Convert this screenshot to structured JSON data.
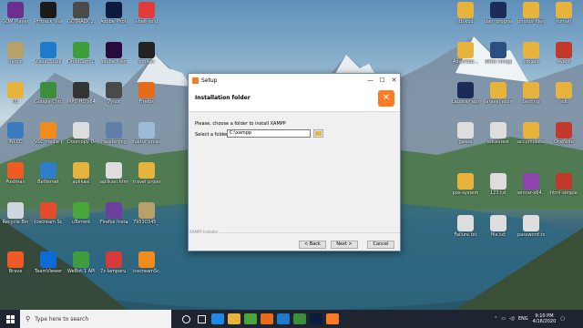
{
  "desktop": {
    "icons": [
      {
        "label": "GOM Player",
        "color": "#6b2f8f"
      },
      {
        "label": "PHtrack Video...",
        "color": "#1b1b1b"
      },
      {
        "label": "GOTRACK 2...",
        "color": "#4a4a4a"
      },
      {
        "label": "Adobe Photosh...",
        "color": "#0c1b3f"
      },
      {
        "label": "shell-void",
        "color": "#e23b3b"
      },
      {
        "label": "heroic",
        "color": "#b8a06a"
      },
      {
        "label": "Visual Studio Code",
        "color": "#1f7acc"
      },
      {
        "label": "DroidCam Client",
        "color": "#3e9e3e"
      },
      {
        "label": "Adobe Premiere",
        "color": "#2a0a3e"
      },
      {
        "label": "project",
        "color": "#222"
      },
      {
        "label": "lib",
        "color": "#e6b43c"
      },
      {
        "label": "Google Chrome",
        "color": "#3c8d3c"
      },
      {
        "label": "MPC-HC x64",
        "color": "#333"
      },
      {
        "label": "Vysor",
        "color": "#4a4a4a"
      },
      {
        "label": "Firefox",
        "color": "#e66b1b"
      },
      {
        "label": "INI.CC",
        "color": "#3b7bbd"
      },
      {
        "label": "VLC media player",
        "color": "#f08c1b"
      },
      {
        "label": "Doorcopy Doc...",
        "color": "#ddd"
      },
      {
        "label": "Headerpng",
        "color": "#5f7fa8"
      },
      {
        "label": "faktur project...",
        "color": "#9bbbd6"
      },
      {
        "label": "Postman",
        "color": "#ef5b25"
      },
      {
        "label": "Betternet",
        "color": "#2f7ec9"
      },
      {
        "label": "aplikasi",
        "color": "#e6b43c"
      },
      {
        "label": "aplikasi.html",
        "color": "#ddd"
      },
      {
        "label": "travel projects...",
        "color": "#e6b43c"
      },
      {
        "label": "Recycle Bin",
        "color": "#cfd8e0"
      },
      {
        "label": "Icecream Screen...",
        "color": "#e24b2b"
      },
      {
        "label": "uTorrent",
        "color": "#4aa53b"
      },
      {
        "label": "Firefox Installer.exe",
        "color": "#6b3f9e"
      },
      {
        "label": "79530345_...",
        "color": "#b8a06a"
      },
      {
        "label": "Brave",
        "color": "#f05a24"
      },
      {
        "label": "TeamViewer",
        "color": "#0e6bd6"
      },
      {
        "label": "WeBot-1 APK 5.6.9.3...",
        "color": "#3e9e3e"
      },
      {
        "label": "7z-lamperu...",
        "color": "#d63a3a"
      },
      {
        "label": "icecreamSc...",
        "color": "#f08c1b"
      },
      {
        "label": "db.kbd",
        "color": "#e6b43c"
      },
      {
        "label": "dani programmer...",
        "color": "#1c2b5a"
      },
      {
        "label": "photos_files",
        "color": "#e6b43c"
      },
      {
        "label": "rumah",
        "color": "#e6b43c"
      },
      {
        "label": "AdvertBE...",
        "color": "#e6b43c"
      },
      {
        "label": "Bitter Images tutorial.png",
        "color": "#2b4f80"
      },
      {
        "label": "project",
        "color": "#e6b43c"
      },
      {
        "label": "event",
        "color": "#c0392b"
      },
      {
        "label": "Laporan eps.docx",
        "color": "#1c2b5a"
      },
      {
        "label": "laravel ecommerce...",
        "color": "#e6b43c"
      },
      {
        "label": "berting",
        "color": "#e6b43c"
      },
      {
        "label": "adt",
        "color": "#e6b43c"
      },
      {
        "label": "gawai",
        "color": "#ddd"
      },
      {
        "label": "adsestest",
        "color": "#ddd"
      },
      {
        "label": "accumulator",
        "color": "#e6b43c"
      },
      {
        "label": "OneNote",
        "color": "#c0392b"
      },
      {
        "label": "pos-system",
        "color": "#e6b43c"
      },
      {
        "label": "123.txt",
        "color": "#ddd"
      },
      {
        "label": "winrar-x64...",
        "color": "#8e44ad"
      },
      {
        "label": "html-simple...",
        "color": "#c0392b"
      },
      {
        "label": "Failure.txt",
        "color": "#ddd"
      },
      {
        "label": "file.txt",
        "color": "#ddd"
      },
      {
        "label": "password.txt",
        "color": "#ddd"
      }
    ]
  },
  "dialog": {
    "title": "Setup",
    "minimize": "—",
    "maximize": "☐",
    "close": "✕",
    "header_title": "Installation folder",
    "logo": "✕",
    "prompt": "Please, choose a folder to install XAMPP",
    "folder_label": "Select a folder",
    "folder_value": "C:\\xampp",
    "footer_brand": "XAMPP Installer",
    "back": "< Back",
    "next": "Next >",
    "cancel": "Cancel"
  },
  "taskbar": {
    "search_placeholder": "Type here to search",
    "apps": [
      {
        "name": "cortana-icon",
        "color": "#fff"
      },
      {
        "name": "task-view-icon",
        "color": "#fff"
      },
      {
        "name": "edge-icon",
        "color": "#1e88e5"
      },
      {
        "name": "explorer-icon",
        "color": "#e6b43c"
      },
      {
        "name": "utorrent-icon",
        "color": "#4aa53b"
      },
      {
        "name": "firefox-icon",
        "color": "#e66b1b"
      },
      {
        "name": "vscode-icon",
        "color": "#1f7acc"
      },
      {
        "name": "chrome-icon",
        "color": "#3c8d3c"
      },
      {
        "name": "photoshop-icon",
        "color": "#0c1b3f"
      },
      {
        "name": "xampp-icon",
        "color": "#fb7a24"
      }
    ],
    "lang": "ENG",
    "time": "9:10 PM",
    "date": "4/16/2020"
  }
}
